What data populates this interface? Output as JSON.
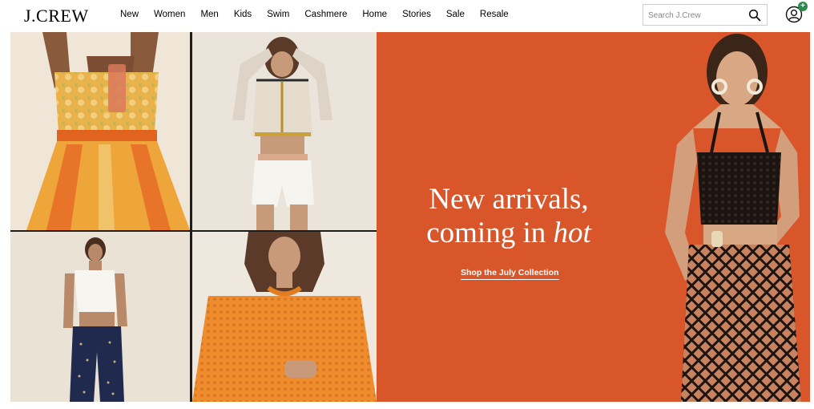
{
  "header": {
    "logo": "J.CREW",
    "nav": [
      "New",
      "Women",
      "Men",
      "Kids",
      "Swim",
      "Cashmere",
      "Home",
      "Stories",
      "Sale",
      "Resale"
    ],
    "search_placeholder": "Search J.Crew",
    "account_badge": "+"
  },
  "hero": {
    "heading_line1": "New arrivals,",
    "heading_line2_prefix": "coming in ",
    "heading_line2_emphasis": "hot",
    "cta_label": "Shop the July Collection"
  },
  "colors": {
    "hero_background": "#d9562b",
    "badge_green": "#2a8c4a"
  },
  "icons": [
    "search-icon",
    "account-icon"
  ]
}
